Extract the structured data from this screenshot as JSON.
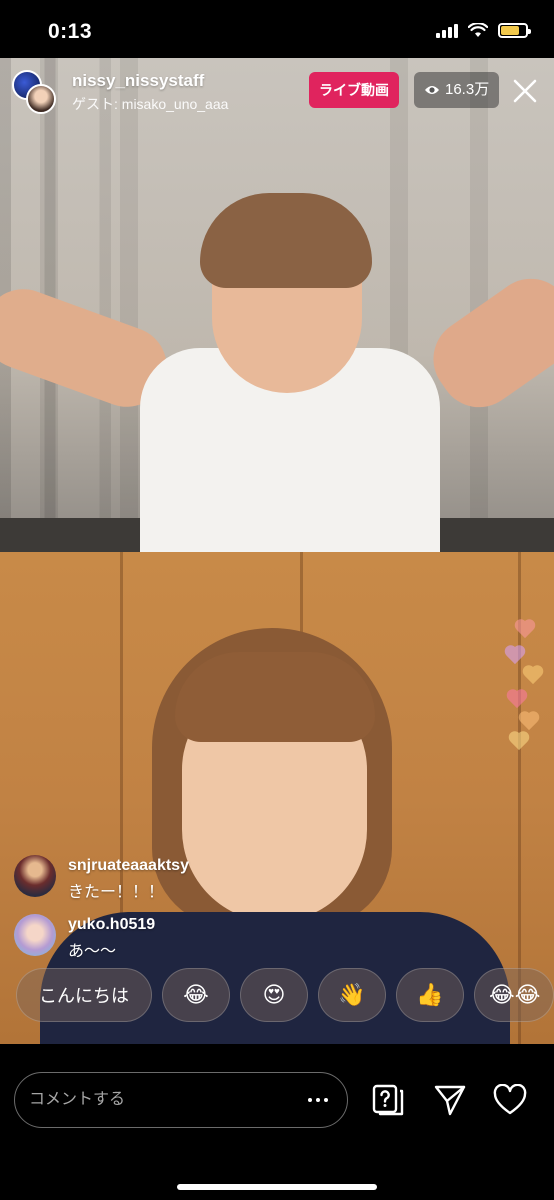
{
  "status_bar": {
    "time": "0:13",
    "battery_level": 0.75,
    "battery_color": "#f2c94c"
  },
  "live": {
    "host_username": "nissy_nissystaff",
    "guest_line": "ゲスト: misako_uno_aaa",
    "live_badge": "ライブ動画",
    "viewer_count": "16.3万",
    "badge_color": "#e0245e"
  },
  "comments": [
    {
      "username": "snjruateaaaktsy",
      "message": "きたー！！！",
      "avatar_color": "#4a3a4f"
    },
    {
      "username": "yuko.h0519",
      "message": "あ〜〜",
      "avatar_color": "#c9b7d8"
    }
  ],
  "quick_replies": [
    {
      "label": "こんにちは",
      "kind": "text"
    },
    {
      "label": "😂",
      "kind": "emoji"
    },
    {
      "label": "😍",
      "kind": "emoji"
    },
    {
      "label": "👋",
      "kind": "emoji"
    },
    {
      "label": "👍",
      "kind": "emoji"
    },
    {
      "label": "😂😂",
      "kind": "emoji"
    }
  ],
  "composer": {
    "placeholder": "コメントする"
  },
  "icons": {
    "viewer": "eye-icon",
    "close": "close-icon",
    "question": "question-icon",
    "share": "paper-plane-icon",
    "like": "heart-icon",
    "more": "more-dots-icon"
  }
}
